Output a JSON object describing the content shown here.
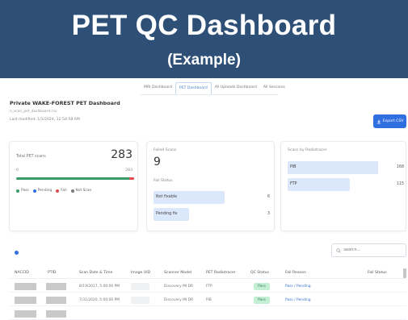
{
  "banner": {
    "title": "PET QC Dashboard",
    "subtitle": "(Example)"
  },
  "tabs": [
    {
      "label": "MRI Dashboard"
    },
    {
      "label": "PET Dashboard",
      "active": true
    },
    {
      "label": "All Uploads Dashboard"
    },
    {
      "label": "All Sessions"
    }
  ],
  "header": {
    "title": "Private WAKE-FOREST PET Dashboard",
    "file": "n_scan_pet_dashboard.csv",
    "modified": "Last modified: 1/1/2024, 12:54:58 AM",
    "export_label": "Export CSV"
  },
  "total_card": {
    "label": "Total PET scans",
    "total": "283",
    "min": "0",
    "max": "283",
    "pass_fraction": 0.96,
    "legend": [
      {
        "label": "Pass",
        "color": "#3a9b6a"
      },
      {
        "label": "Pending",
        "color": "#2f6fe0"
      },
      {
        "label": "Fail",
        "color": "#e14b4b"
      },
      {
        "label": "Not Scan",
        "color": "#7a7a7a"
      }
    ]
  },
  "failed_card": {
    "label": "Failed Scans",
    "count": "9",
    "fail_status_label": "Fail Status",
    "bars": [
      {
        "label": "Not fixable",
        "value": "6",
        "fraction": 1.0
      },
      {
        "label": "Pending fix",
        "value": "3",
        "fraction": 0.5
      }
    ]
  },
  "radiotracer_card": {
    "label": "Scans by Radiotracer",
    "bars": [
      {
        "label": "PiB",
        "value": "168",
        "fraction": 0.77
      },
      {
        "label": "FTP",
        "value": "115",
        "fraction": 0.53
      }
    ]
  },
  "search": {
    "placeholder": "Search..."
  },
  "table": {
    "headers": [
      "NACCID",
      "PTID",
      "Scan Date & Time",
      "Image UID",
      "Scanner Model",
      "PET Radiotracer",
      "QC Status",
      "Fail Reason",
      "Fail Status"
    ],
    "rows": [
      {
        "scan_date": "8/19/2017, 5:00:00 PM",
        "scanner": "Discovery MI DR",
        "tracer": "FTP",
        "qc": "Pass",
        "reason": "Pass / Pending"
      },
      {
        "scan_date": "7/31/2020, 5:00:00 PM",
        "scanner": "Discovery MI DR",
        "tracer": "PiB",
        "qc": "Pass",
        "reason": "Pass / Pending"
      }
    ]
  },
  "colors": {
    "banner": "#2e5077",
    "accent": "#2f6fe0",
    "pass": "#3a9b6a",
    "fail": "#e14b4b"
  }
}
